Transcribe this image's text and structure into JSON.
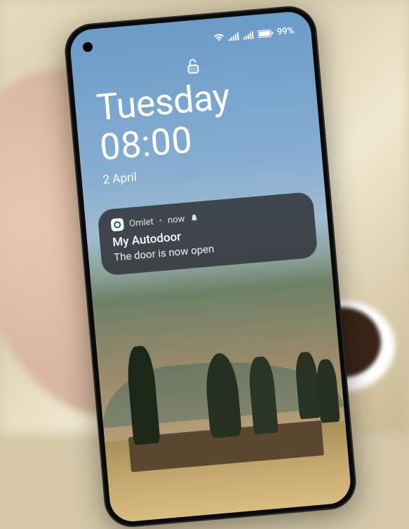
{
  "status": {
    "battery_text": "99%"
  },
  "lockscreen": {
    "day": "Tuesday",
    "time": "08:00",
    "date": "2 April"
  },
  "notification": {
    "app_name": "Omlet",
    "time_label": "now",
    "title": "My Autodoor",
    "body": "The door is now open"
  }
}
